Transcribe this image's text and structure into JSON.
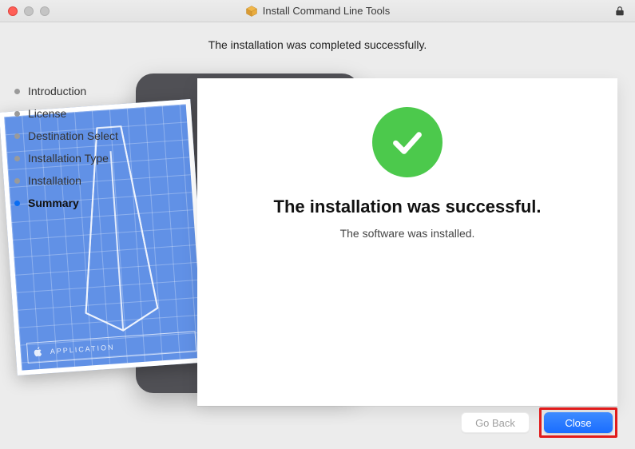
{
  "window": {
    "title": "Install Command Line Tools"
  },
  "header": {
    "subtitle": "The installation was completed successfully."
  },
  "sidebar": {
    "steps": [
      {
        "label": "Introduction",
        "active": false
      },
      {
        "label": "License",
        "active": false
      },
      {
        "label": "Destination Select",
        "active": false
      },
      {
        "label": "Installation Type",
        "active": false
      },
      {
        "label": "Installation",
        "active": false
      },
      {
        "label": "Summary",
        "active": true
      }
    ]
  },
  "main": {
    "headline": "The installation was successful.",
    "subline": "The software was installed."
  },
  "buttons": {
    "go_back": "Go Back",
    "close": "Close"
  },
  "colors": {
    "primary_blue": "#1a6dff",
    "success_green": "#4cc94c",
    "highlight_red": "#e11b1b"
  },
  "blueprint": {
    "footer_text": "APPLICATION"
  }
}
